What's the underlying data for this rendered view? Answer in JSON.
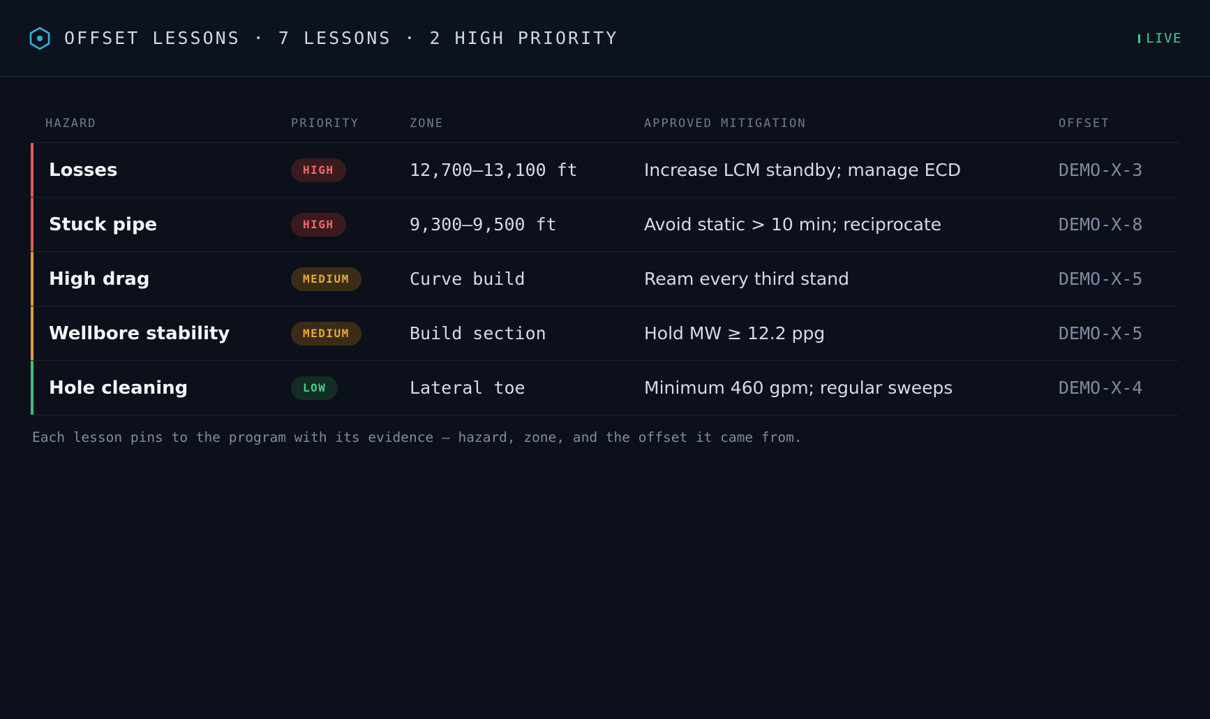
{
  "header": {
    "title": "OFFSET LESSONS · 7 LESSONS · 2 HIGH PRIORITY",
    "live_label": "LIVE",
    "logo_icon": "hexagon-icon"
  },
  "colors": {
    "background": "#0b101a",
    "high": "#ef6a6a",
    "medium": "#e6a83c",
    "low": "#3fcf8e",
    "accent": "#2fb4d6"
  },
  "table": {
    "columns": {
      "hazard": "HAZARD",
      "priority": "PRIORITY",
      "zone": "ZONE",
      "mitigation": "APPROVED MITIGATION",
      "offset": "OFFSET"
    },
    "rows": [
      {
        "hazard": "Losses",
        "priority": "HIGH",
        "level": "high",
        "zone": "12,700–13,100 ft",
        "mitigation": "Increase LCM standby; manage ECD",
        "offset": "DEMO-X-3"
      },
      {
        "hazard": "Stuck pipe",
        "priority": "HIGH",
        "level": "high",
        "zone": "9,300–9,500 ft",
        "mitigation": "Avoid static > 10 min; reciprocate",
        "offset": "DEMO-X-8"
      },
      {
        "hazard": "High drag",
        "priority": "MEDIUM",
        "level": "medium",
        "zone": "Curve build",
        "mitigation": "Ream every third stand",
        "offset": "DEMO-X-5"
      },
      {
        "hazard": "Wellbore stability",
        "priority": "MEDIUM",
        "level": "medium",
        "zone": "Build section",
        "mitigation": "Hold MW ≥ 12.2 ppg",
        "offset": "DEMO-X-5"
      },
      {
        "hazard": "Hole cleaning",
        "priority": "LOW",
        "level": "low",
        "zone": "Lateral toe",
        "mitigation": "Minimum 460 gpm; regular sweeps",
        "offset": "DEMO-X-4"
      }
    ]
  },
  "footnote": "Each lesson pins to the program with its evidence — hazard, zone, and the offset it came from."
}
